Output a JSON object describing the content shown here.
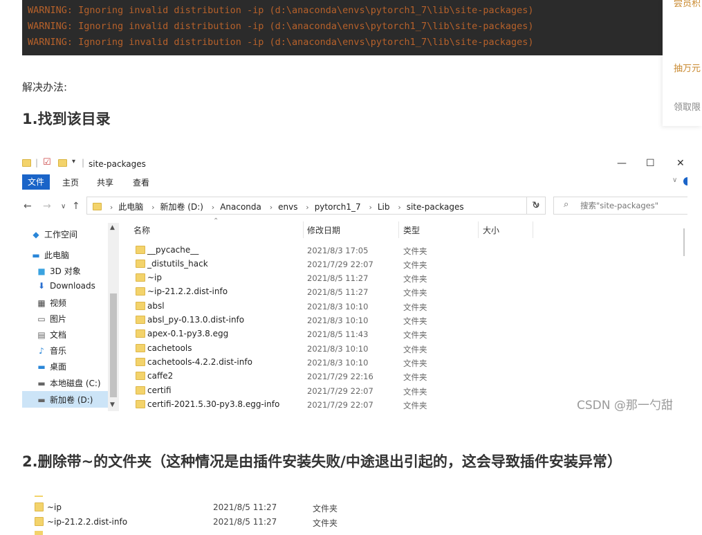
{
  "terminal": {
    "lines": [
      "WARNING: Ignoring invalid distribution -ip (d:\\anaconda\\envs\\pytorch1_7\\lib\\site-packages)",
      "WARNING: Ignoring invalid distribution -ip (d:\\anaconda\\envs\\pytorch1_7\\lib\\site-packages)",
      "WARNING: Ignoring invalid distribution -ip (d:\\anaconda\\envs\\pytorch1_7\\lib\\site-packages)"
    ]
  },
  "side_panel": {
    "items": [
      "尝员积",
      "抽万元",
      "领取限"
    ]
  },
  "article": {
    "intro": "解决办法:",
    "step1": "1.找到该目录",
    "step2": "2.删除带~的文件夹（这种情况是由插件安装失败/中途退出引起的，这会导致插件安装异常）",
    "watermark": "CSDN @那一勺甜"
  },
  "explorer": {
    "title": "site-packages",
    "window_controls": {
      "minimize": "—",
      "maximize": "☐",
      "close": "✕"
    },
    "ribbon_tabs": [
      "文件",
      "主页",
      "共享",
      "查看"
    ],
    "breadcrumb": [
      "此电脑",
      "新加卷 (D:)",
      "Anaconda",
      "envs",
      "pytorch1_7",
      "Lib",
      "site-packages"
    ],
    "search_placeholder": "搜索\"site-packages\"",
    "nav_items": [
      "工作空间",
      "此电脑",
      "3D 对象",
      "Downloads",
      "视频",
      "图片",
      "文档",
      "音乐",
      "桌面",
      "本地磁盘 (C:)",
      "新加卷 (D:)"
    ],
    "columns": [
      "名称",
      "修改日期",
      "类型",
      "大小"
    ],
    "files": [
      {
        "name": "__pycache__",
        "date": "2021/8/3 17:05",
        "type": "文件夹"
      },
      {
        "name": "_distutils_hack",
        "date": "2021/7/29 22:07",
        "type": "文件夹"
      },
      {
        "name": "~ip",
        "date": "2021/8/5 11:27",
        "type": "文件夹"
      },
      {
        "name": "~ip-21.2.2.dist-info",
        "date": "2021/8/5 11:27",
        "type": "文件夹"
      },
      {
        "name": "absl",
        "date": "2021/8/3 10:10",
        "type": "文件夹"
      },
      {
        "name": "absl_py-0.13.0.dist-info",
        "date": "2021/8/3 10:10",
        "type": "文件夹"
      },
      {
        "name": "apex-0.1-py3.8.egg",
        "date": "2021/8/5 11:43",
        "type": "文件夹"
      },
      {
        "name": "cachetools",
        "date": "2021/8/3 10:10",
        "type": "文件夹"
      },
      {
        "name": "cachetools-4.2.2.dist-info",
        "date": "2021/8/3 10:10",
        "type": "文件夹"
      },
      {
        "name": "caffe2",
        "date": "2021/7/29 22:16",
        "type": "文件夹"
      },
      {
        "name": "certifi",
        "date": "2021/7/29 22:07",
        "type": "文件夹"
      },
      {
        "name": "certifi-2021.5.30-py3.8.egg-info",
        "date": "2021/7/29 22:07",
        "type": "文件夹"
      }
    ]
  },
  "snippet": {
    "files": [
      {
        "name": "~ip",
        "date": "2021/8/5 11:27",
        "type": "文件夹"
      },
      {
        "name": "~ip-21.2.2.dist-info",
        "date": "2021/8/5 11:27",
        "type": "文件夹"
      }
    ]
  },
  "colors": {
    "terminal_bg": "#2b2b2b",
    "terminal_text": "#b6612b",
    "accent": "#1a64c8",
    "folder": "#f3d36b",
    "side_link": "#c9892f"
  }
}
